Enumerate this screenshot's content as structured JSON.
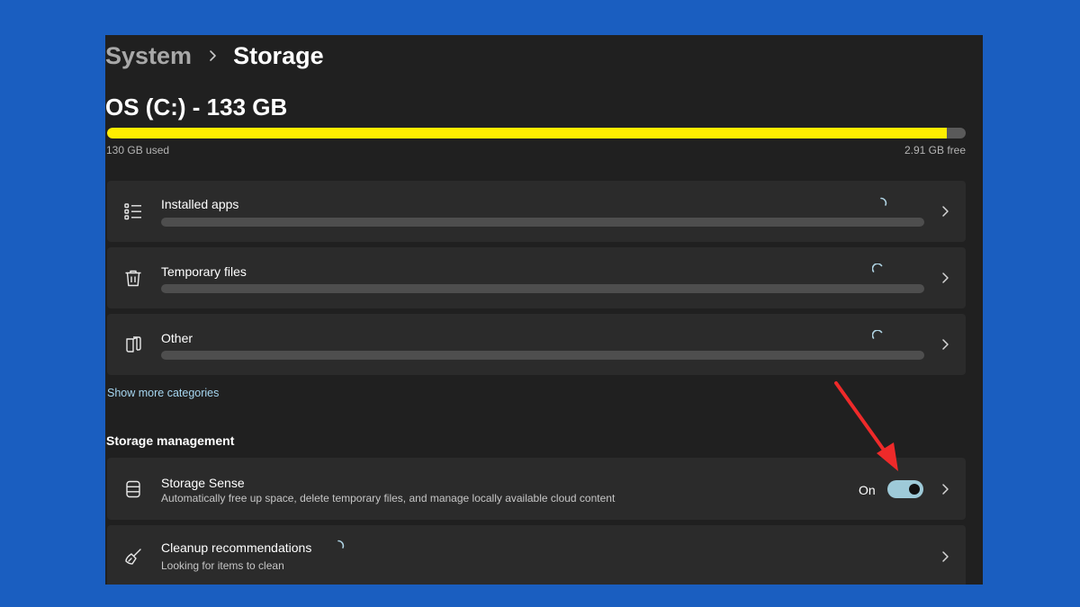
{
  "breadcrumb": {
    "parent": "System",
    "current": "Storage"
  },
  "drive": {
    "title": "OS (C:) - 133 GB",
    "used_label": "130 GB used",
    "free_label": "2.91 GB free",
    "used_fraction": 0.978
  },
  "categories": [
    {
      "label": "Installed apps",
      "icon": "app-list-icon"
    },
    {
      "label": "Temporary files",
      "icon": "trash-icon"
    },
    {
      "label": "Other",
      "icon": "documents-icon"
    }
  ],
  "show_more_link": "Show more categories",
  "storage_management": {
    "heading": "Storage management",
    "storage_sense": {
      "title": "Storage Sense",
      "description": "Automatically free up space, delete temporary files, and manage locally available cloud content",
      "toggle_state": "On",
      "toggle_on": true
    },
    "cleanup": {
      "title": "Cleanup recommendations",
      "description": "Looking for items to clean"
    }
  },
  "colors": {
    "background": "#1a5ec0",
    "window": "#202020",
    "card": "#2b2b2b",
    "usage_fill": "#ffee00",
    "toggle_on": "#9ecad8",
    "annotation_arrow": "#ee2a2a"
  }
}
